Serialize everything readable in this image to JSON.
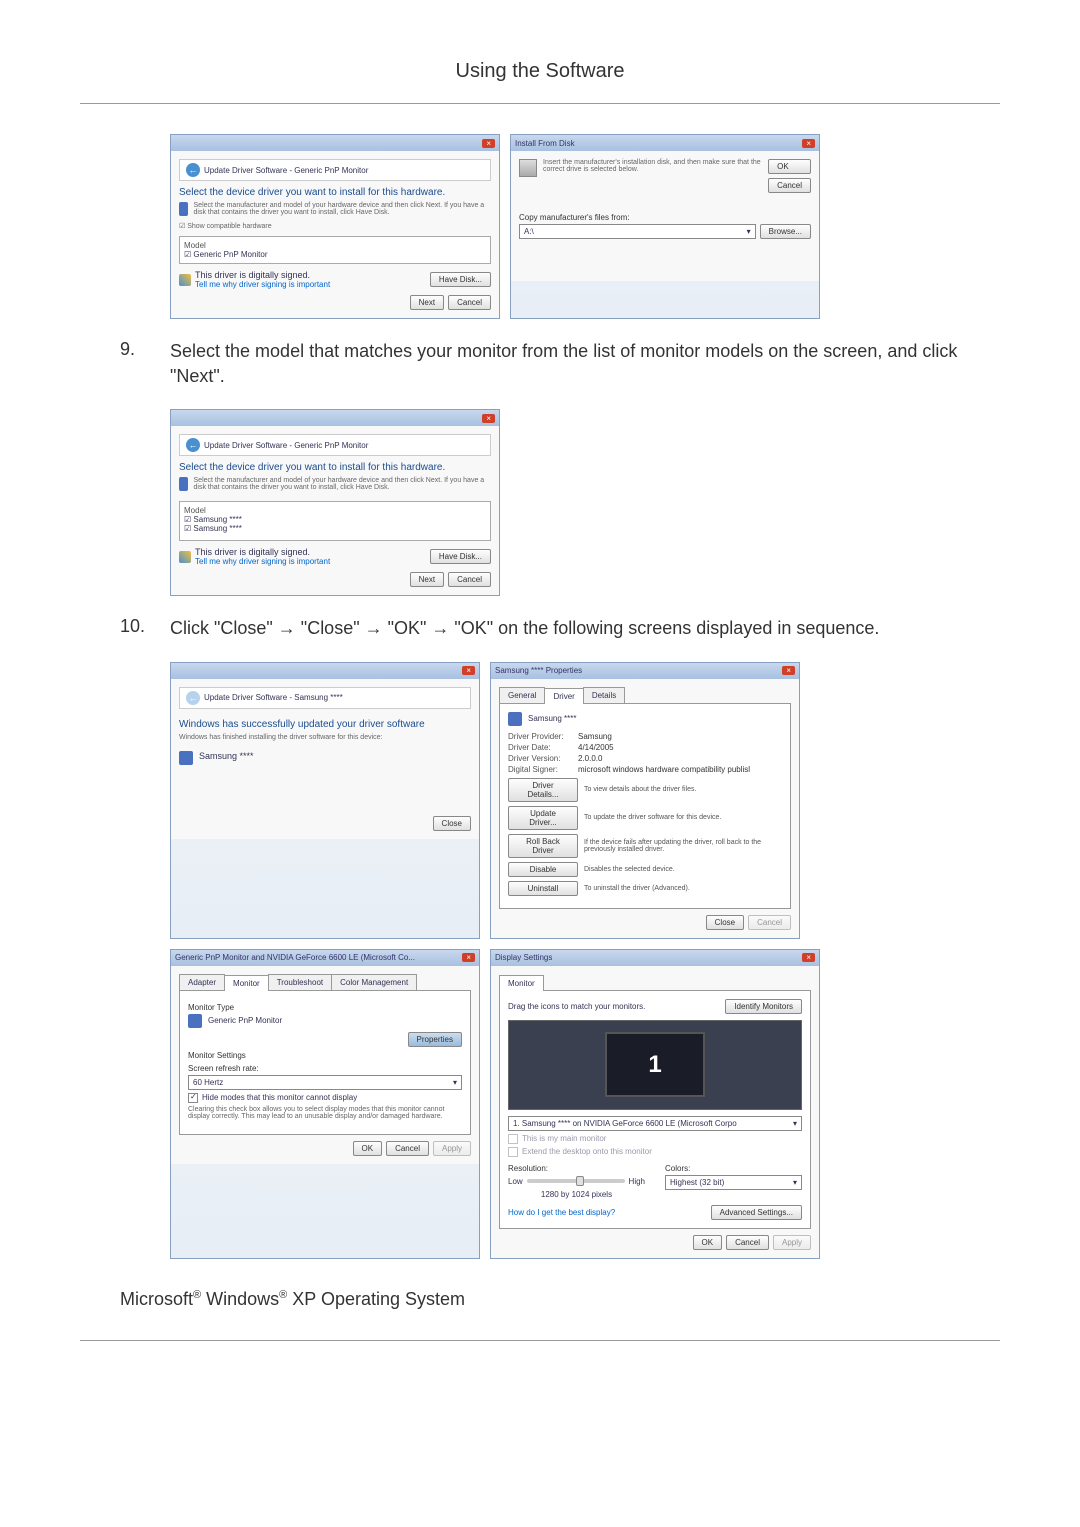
{
  "header": "Using the Software",
  "step9": {
    "num": "9.",
    "text": "Select the model that matches your monitor from the list of monitor models on the screen, and click \"Next\"."
  },
  "step10": {
    "num": "10.",
    "text": "Click \"Close\" → \"Close\" → \"OK\" → \"OK\" on the following screens displayed in sequence."
  },
  "footer": "Microsoft® Windows® XP Operating System",
  "win_update1": {
    "breadcrumb": "Update Driver Software - Generic PnP Monitor",
    "heading": "Select the device driver you want to install for this hardware.",
    "desc": "Select the manufacturer and model of your hardware device and then click Next. If you have a disk that contains the driver you want to install, click Have Disk.",
    "compat": "☑ Show compatible hardware",
    "model_hdr": "Model",
    "model1": "Generic PnP Monitor",
    "sig": "This driver is digitally signed.",
    "siglink": "Tell me why driver signing is important",
    "havedisk": "Have Disk...",
    "next": "Next",
    "cancel": "Cancel"
  },
  "win_fromdisk": {
    "title": "Install From Disk",
    "desc": "Insert the manufacturer's installation disk, and then make sure that the correct drive is selected below.",
    "ok": "OK",
    "cancel": "Cancel",
    "copy": "Copy manufacturer's files from:",
    "path": "A:\\",
    "browse": "Browse..."
  },
  "win_update2": {
    "breadcrumb": "Update Driver Software - Generic PnP Monitor",
    "heading": "Select the device driver you want to install for this hardware.",
    "desc": "Select the manufacturer and model of your hardware device and then click Next. If you have a disk that contains the driver you want to install, click Have Disk.",
    "model_hdr": "Model",
    "m1": "Samsung ****",
    "m2": "Samsung ****",
    "sig": "This driver is digitally signed.",
    "siglink": "Tell me why driver signing is important",
    "havedisk": "Have Disk...",
    "next": "Next",
    "cancel": "Cancel"
  },
  "win_success": {
    "breadcrumb": "Update Driver Software - Samsung ****",
    "heading": "Windows has successfully updated your driver software",
    "desc": "Windows has finished installing the driver software for this device:",
    "device": "Samsung ****",
    "close": "Close"
  },
  "win_props": {
    "title": "Samsung **** Properties",
    "tab_general": "General",
    "tab_driver": "Driver",
    "tab_details": "Details",
    "device": "Samsung ****",
    "provider_l": "Driver Provider:",
    "provider_v": "Samsung",
    "date_l": "Driver Date:",
    "date_v": "4/14/2005",
    "version_l": "Driver Version:",
    "version_v": "2.0.0.0",
    "signer_l": "Digital Signer:",
    "signer_v": "microsoft windows hardware compatibility publisl",
    "details_btn": "Driver Details...",
    "details_desc": "To view details about the driver files.",
    "update_btn": "Update Driver...",
    "update_desc": "To update the driver software for this device.",
    "rollback_btn": "Roll Back Driver",
    "rollback_desc": "If the device fails after updating the driver, roll back to the previously installed driver.",
    "disable_btn": "Disable",
    "disable_desc": "Disables the selected device.",
    "uninstall_btn": "Uninstall",
    "uninstall_desc": "To uninstall the driver (Advanced).",
    "close": "Close",
    "cancel": "Cancel"
  },
  "win_monitor": {
    "title": "Generic PnP Monitor and NVIDIA GeForce 6600 LE (Microsoft Co...",
    "tab_adapter": "Adapter",
    "tab_monitor": "Monitor",
    "tab_trouble": "Troubleshoot",
    "tab_color": "Color Management",
    "type_label": "Monitor Type",
    "type_val": "Generic PnP Monitor",
    "props_btn": "Properties",
    "settings_label": "Monitor Settings",
    "refresh_label": "Screen refresh rate:",
    "refresh_val": "60 Hertz",
    "hide_check": "Hide modes that this monitor cannot display",
    "hide_desc": "Clearing this check box allows you to select display modes that this monitor cannot display correctly. This may lead to an unusable display and/or damaged hardware.",
    "ok": "OK",
    "cancel": "Cancel",
    "apply": "Apply"
  },
  "win_display": {
    "title": "Display Settings",
    "tab": "Monitor",
    "drag": "Drag the icons to match your monitors.",
    "identify": "Identify Monitors",
    "num": "1",
    "dropdown": "1. Samsung **** on NVIDIA GeForce 6600 LE (Microsoft Corpo",
    "main_check": "This is my main monitor",
    "extend_check": "Extend the desktop onto this monitor",
    "res_label": "Resolution:",
    "colors_label": "Colors:",
    "low": "Low",
    "high": "High",
    "res_val": "1280 by 1024 pixels",
    "color_val": "Highest (32 bit)",
    "help": "How do I get the best display?",
    "advanced": "Advanced Settings...",
    "ok": "OK",
    "cancel": "Cancel",
    "apply": "Apply"
  }
}
